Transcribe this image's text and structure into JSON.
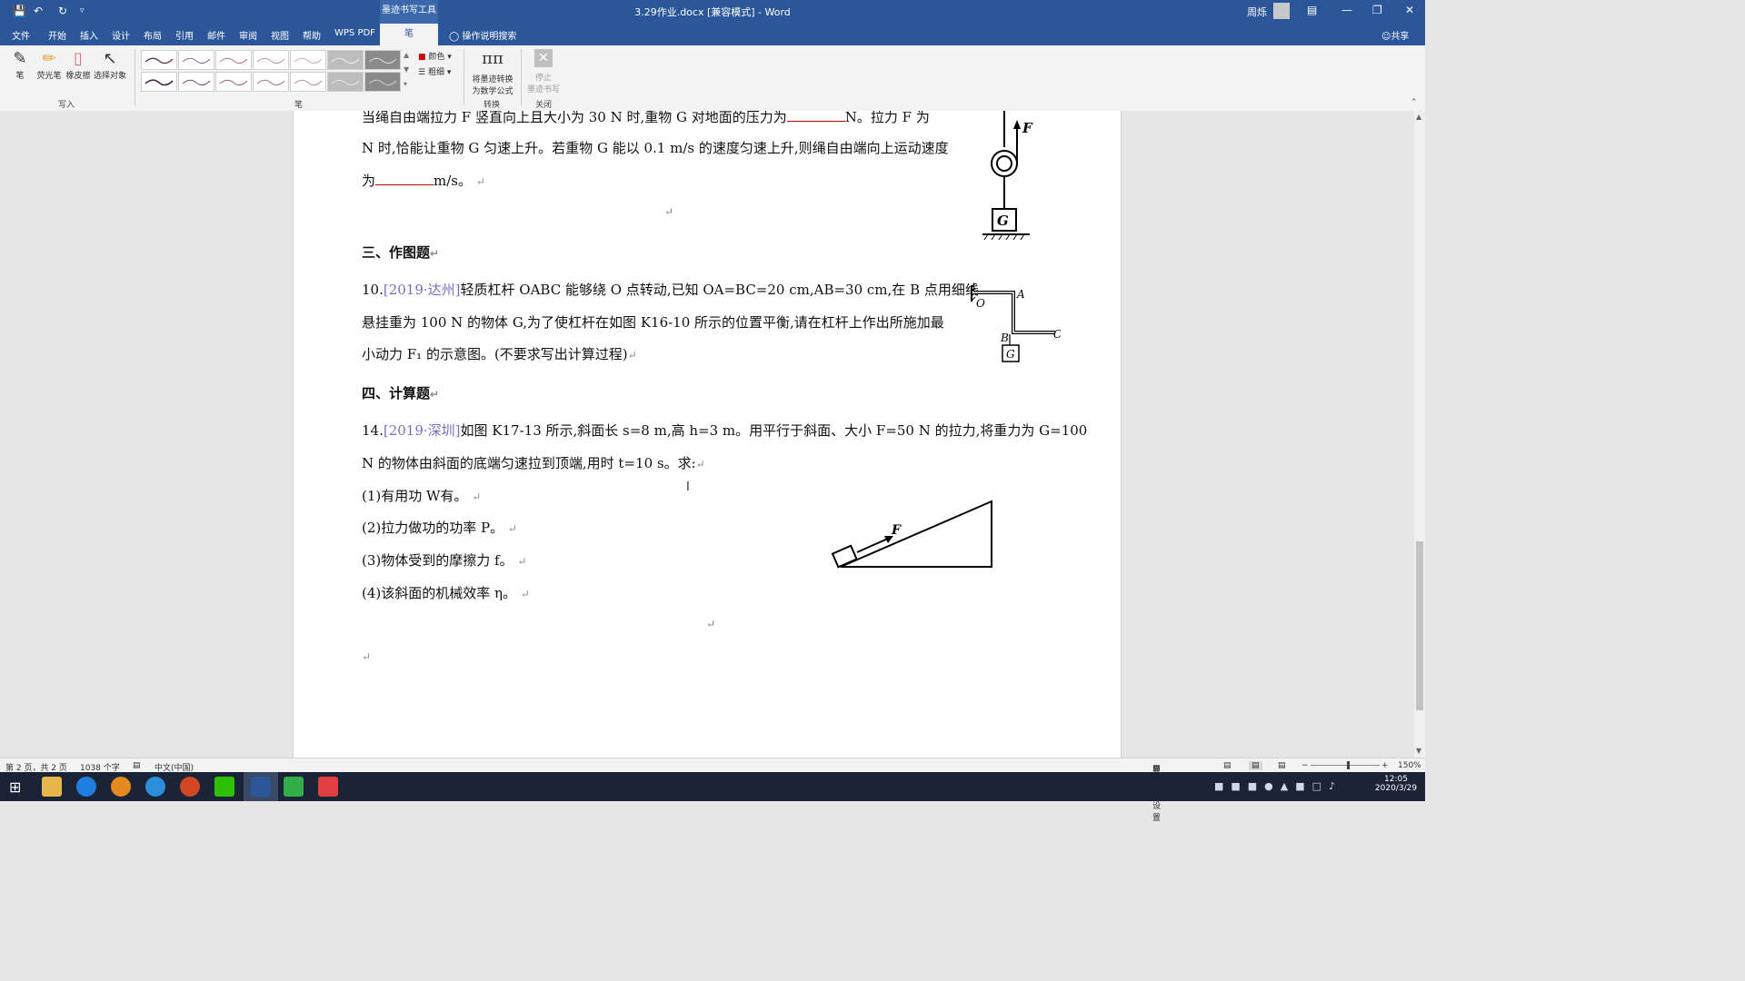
{
  "window": {
    "title": "3.29作业.docx [兼容模式] - Word",
    "contextual_tab": "墨迹书写工具",
    "user_name": "周烁"
  },
  "tabs": [
    "文件",
    "开始",
    "插入",
    "设计",
    "布局",
    "引用",
    "邮件",
    "审阅",
    "视图",
    "帮助",
    "WPS PDF",
    "笔"
  ],
  "active_tab": "笔",
  "tell_me": "操作说明搜索",
  "share": "共享",
  "ribbon": {
    "write_tools": [
      "笔",
      "荧光笔",
      "橡皮擦",
      "选择对象"
    ],
    "write_group": "写入",
    "pens_group": "笔",
    "color_label": "颜色",
    "thickness_label": "粗细",
    "convert_label_1": "将墨迹转换",
    "convert_label_2": "为数学公式",
    "convert_group": "转换",
    "stop_label_1": "停止",
    "stop_label_2": "墨迹书写",
    "close_group": "关闭"
  },
  "document": {
    "line1_a": "当绳自由端拉力 F 竖直向上且大小为 30 N 时,重物 G 对地面的压力为",
    "line1_b": "N。拉力 F 为",
    "line2": "N 时,恰能让重物 G 匀速上升。若重物 G 能以 0.1 m/s 的速度匀速上升,则绳自由端向上运动速度",
    "line3_a": "为",
    "line3_b": "m/s。",
    "section3": "三、作图题",
    "q10_num": "10.",
    "q10_src": "[2019·达州]",
    "q10_l1": "轻质杠杆 OABC 能够绕 O 点转动,已知 OA=BC=20 cm,AB=30 cm,在 B 点用细线",
    "q10_l2": "悬挂重为 100 N 的物体 G,为了使杠杆在如图 K16-10 所示的位置平衡,请在杠杆上作出所施加最",
    "q10_l3": "小动力 F₁ 的示意图。(不要求写出计算过程)",
    "section4": "四、计算题",
    "q14_num": "14.",
    "q14_src": "[2019·深圳]",
    "q14_l1": "如图 K17-13 所示,斜面长 s=8 m,高 h=3 m。用平行于斜面、大小 F=50 N 的拉力,将重力为 G=100",
    "q14_l2": "N 的物体由斜面的底端匀速拉到顶端,用时 t=10 s。求:",
    "q14_p1": "(1)有用功 W有。",
    "q14_p2": "(2)拉力做功的功率 P。",
    "q14_p3": "(3)物体受到的摩擦力 f。",
    "q14_p4": "(4)该斜面的机械效率 η。",
    "para_mark": "↵",
    "fig_pulley_F": "F",
    "fig_pulley_G": "G",
    "fig_lever_O": "O",
    "fig_lever_A": "A",
    "fig_lever_B": "B",
    "fig_lever_C": "C",
    "fig_lever_G": "G",
    "fig_incline_F": "F"
  },
  "status": {
    "page": "第 2 页，共 2 页",
    "words": "1038 个字",
    "language": "中文(中国)",
    "display_settings": "显示器设置",
    "zoom": "150%"
  },
  "clock": {
    "time": "12:05",
    "date": "2020/3/29"
  },
  "colors": {
    "word_blue": "#2b579a",
    "taskbar": "#1b2436"
  }
}
